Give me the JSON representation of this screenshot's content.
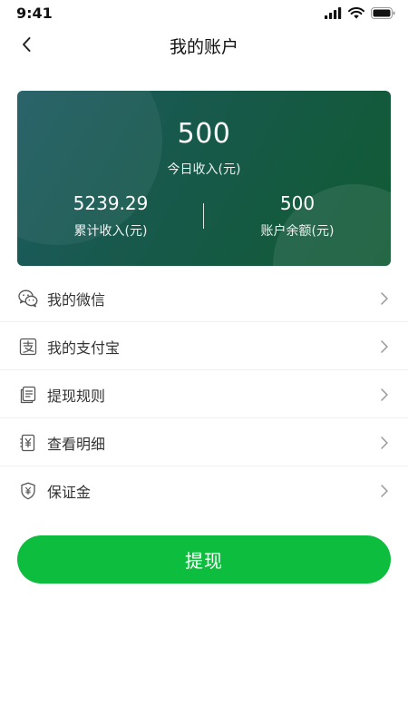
{
  "status_bar": {
    "time": "9:41"
  },
  "nav": {
    "title": "我的账户"
  },
  "summary": {
    "today_income_value": "500",
    "today_income_label": "今日收入(元)",
    "total_income_value": "5239.29",
    "total_income_label": "累计收入(元)",
    "balance_value": "500",
    "balance_label": "账户余额(元)"
  },
  "menu": {
    "items": [
      {
        "label": "我的微信",
        "icon": "wechat-icon"
      },
      {
        "label": "我的支付宝",
        "icon": "alipay-icon"
      },
      {
        "label": "提现规则",
        "icon": "document-icon"
      },
      {
        "label": "查看明细",
        "icon": "receipt-icon"
      },
      {
        "label": "保证金",
        "icon": "shield-icon"
      }
    ]
  },
  "actions": {
    "withdraw_label": "提现"
  },
  "colors": {
    "accent": "#0dbd3d",
    "card_gradient_start": "#1d5a62",
    "card_gradient_end": "#105a33"
  }
}
